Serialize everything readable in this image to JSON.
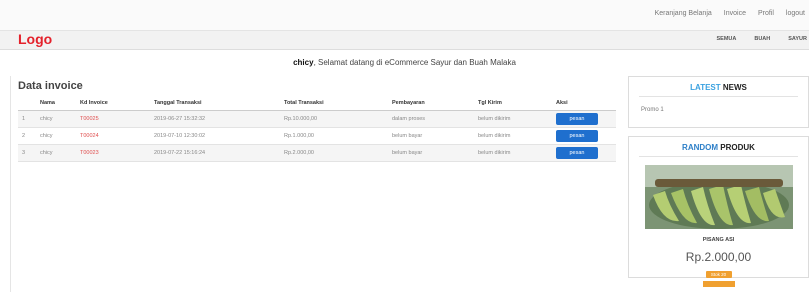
{
  "top_links": [
    "Keranjang Belanja",
    "Invoice",
    "Profil",
    "logout"
  ],
  "logo": "Logo",
  "nav_links": [
    "SEMUA",
    "BUAH",
    "SAYUR"
  ],
  "welcome": {
    "user": "chicy",
    "message": ", Selamat datang di eCommerce Sayur dan Buah Malaka"
  },
  "invoice": {
    "title": "Data invoice",
    "columns": [
      "",
      "Nama",
      "Kd Invoice",
      "Tanggal Transaksi",
      "Total Transaksi",
      "Pembayaran",
      "Tgl Kirim",
      "Aksi"
    ],
    "rows": [
      {
        "no": "1",
        "nama": "chicy",
        "kd": "T00025",
        "tanggal": "2019-06-27 15:32:32",
        "total": "Rp.10.000,00",
        "pembayaran": "dalam proses",
        "tgl_kirim": "belum dikirim",
        "aksi": "pesan"
      },
      {
        "no": "2",
        "nama": "chicy",
        "kd": "T00024",
        "tanggal": "2019-07-10 12:30:02",
        "total": "Rp.1.000,00",
        "pembayaran": "belum bayar",
        "tgl_kirim": "belum dikirim",
        "aksi": "pesan"
      },
      {
        "no": "3",
        "nama": "chicy",
        "kd": "T00023",
        "tanggal": "2019-07-22 15:16:24",
        "total": "Rp.2.000,00",
        "pembayaran": "belum bayar",
        "tgl_kirim": "belum dikirim",
        "aksi": "pesan"
      }
    ]
  },
  "latest_news": {
    "title_a": "LATEST",
    "title_b": "NEWS",
    "item": "Promo 1"
  },
  "random_product": {
    "title_a": "RANDOM",
    "title_b": "PRODUK",
    "name": "PISANG ASI",
    "price": "Rp.2.000,00",
    "stock": "Stok 20"
  }
}
